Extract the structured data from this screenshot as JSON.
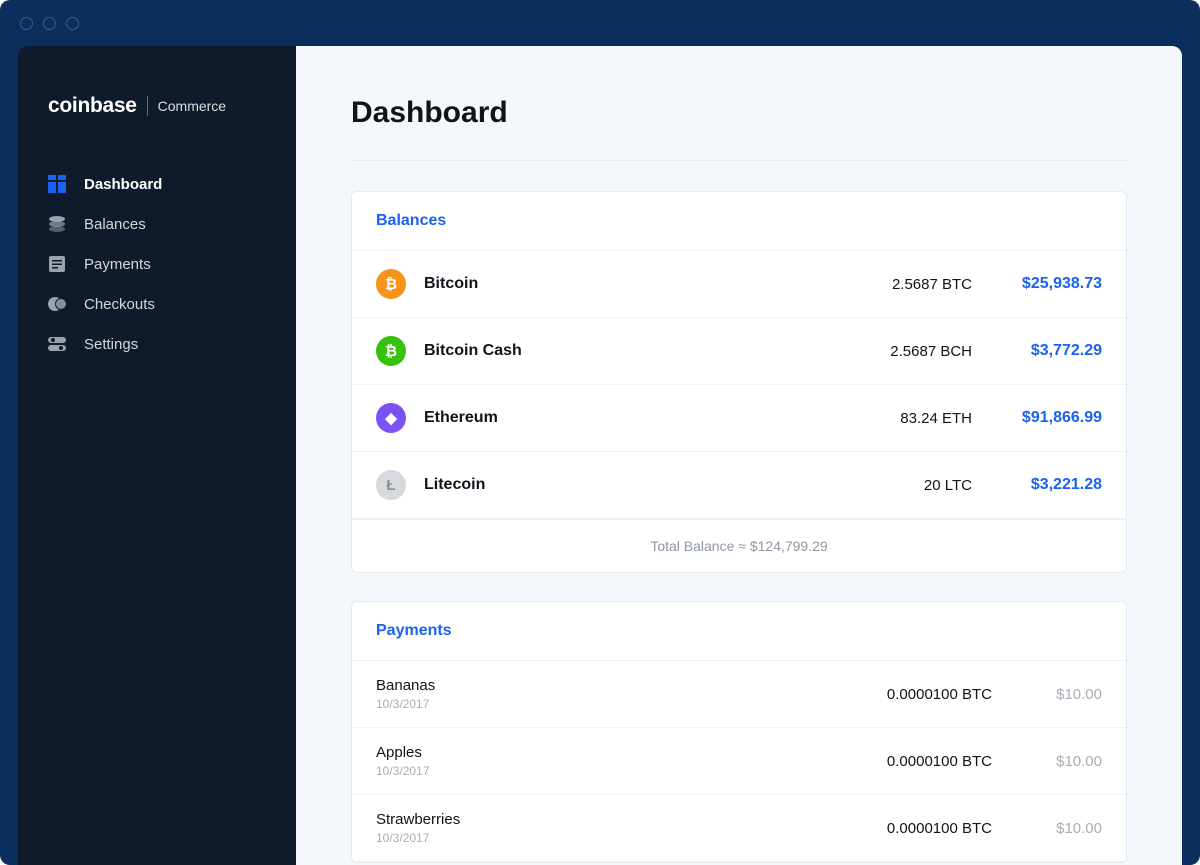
{
  "brand": {
    "main": "coinbase",
    "sub": "Commerce"
  },
  "sidebar": {
    "items": [
      {
        "label": "Dashboard",
        "active": true
      },
      {
        "label": "Balances",
        "active": false
      },
      {
        "label": "Payments",
        "active": false
      },
      {
        "label": "Checkouts",
        "active": false
      },
      {
        "label": "Settings",
        "active": false
      }
    ]
  },
  "page": {
    "title": "Dashboard"
  },
  "balances_card": {
    "title": "Balances",
    "items": [
      {
        "name": "Bitcoin",
        "amount": "2.5687 BTC",
        "usd": "$25,938.73",
        "iconBg": "#f7931a",
        "iconGlyph": "₿"
      },
      {
        "name": "Bitcoin Cash",
        "amount": "2.5687 BCH",
        "usd": "$3,772.29",
        "iconBg": "#38c20e",
        "iconGlyph": "₿"
      },
      {
        "name": "Ethereum",
        "amount": "83.24 ETH",
        "usd": "$91,866.99",
        "iconBg": "#7b52f4",
        "iconGlyph": "◆"
      },
      {
        "name": "Litecoin",
        "amount": "20 LTC",
        "usd": "$3,221.28",
        "iconBg": "#d6d9dd",
        "iconGlyph": "Ł"
      }
    ],
    "footer": "Total Balance ≈ $124,799.29"
  },
  "payments_card": {
    "title": "Payments",
    "items": [
      {
        "name": "Bananas",
        "date": "10/3/2017",
        "amount": "0.0000100 BTC",
        "usd": "$10.00"
      },
      {
        "name": "Apples",
        "date": "10/3/2017",
        "amount": "0.0000100 BTC",
        "usd": "$10.00"
      },
      {
        "name": "Strawberries",
        "date": "10/3/2017",
        "amount": "0.0000100 BTC",
        "usd": "$10.00"
      }
    ]
  }
}
